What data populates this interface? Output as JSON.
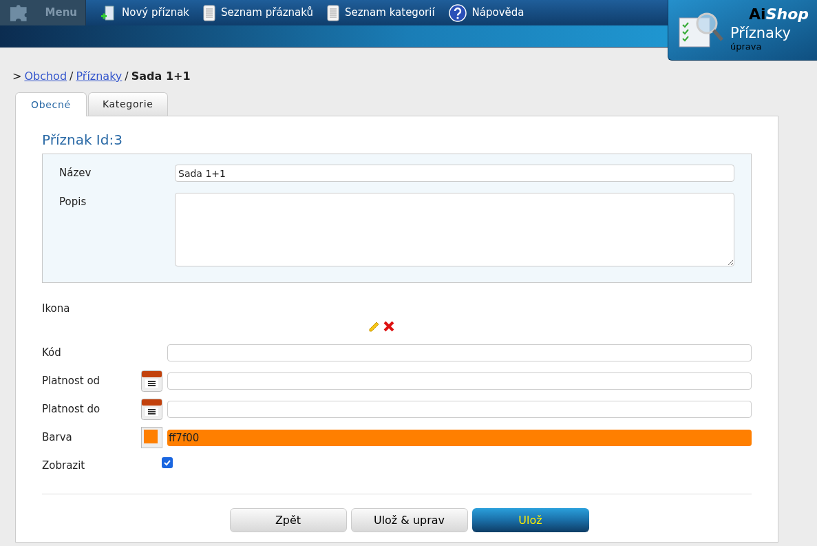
{
  "menu": {
    "label": "Menu"
  },
  "toolbar": [
    {
      "label": "Nový příznak",
      "kind": "new"
    },
    {
      "label": "Seznam přáznaků",
      "kind": "list"
    },
    {
      "label": "Seznam kategorií",
      "kind": "list"
    },
    {
      "label": "Nápověda",
      "kind": "help"
    }
  ],
  "brand": {
    "logo_bold": "Ai",
    "logo_italic": "Shop",
    "title": "Příznaky",
    "subtitle": "úprava"
  },
  "breadcrumb": {
    "prefix": ">",
    "separator": "/",
    "links": [
      "Obchod",
      "Příznaky"
    ],
    "current": "Sada 1+1"
  },
  "tabs": [
    {
      "label": "Obecné",
      "selected": true
    },
    {
      "label": "Kategorie",
      "selected": false
    }
  ],
  "heading": "Příznak Id:3",
  "name_field": {
    "label": "Název",
    "value": "Sada 1+1"
  },
  "description_field": {
    "label": "Popis"
  },
  "icon_row": {
    "label": "Ikona"
  },
  "fields": [
    {
      "label": "Kód",
      "kind": "text"
    },
    {
      "label": "Platnost od",
      "kind": "date"
    },
    {
      "label": "Platnost do",
      "kind": "date"
    },
    {
      "label": "Barva",
      "kind": "color",
      "value": "ff7f00",
      "color": "#ff7f00"
    }
  ],
  "show": {
    "label": "Zobrazit",
    "checked": true
  },
  "buttons": [
    {
      "label": "Zpět",
      "kind": "default"
    },
    {
      "label": "Ulož & uprav",
      "kind": "default"
    },
    {
      "label": "Ulož",
      "kind": "primary"
    }
  ]
}
